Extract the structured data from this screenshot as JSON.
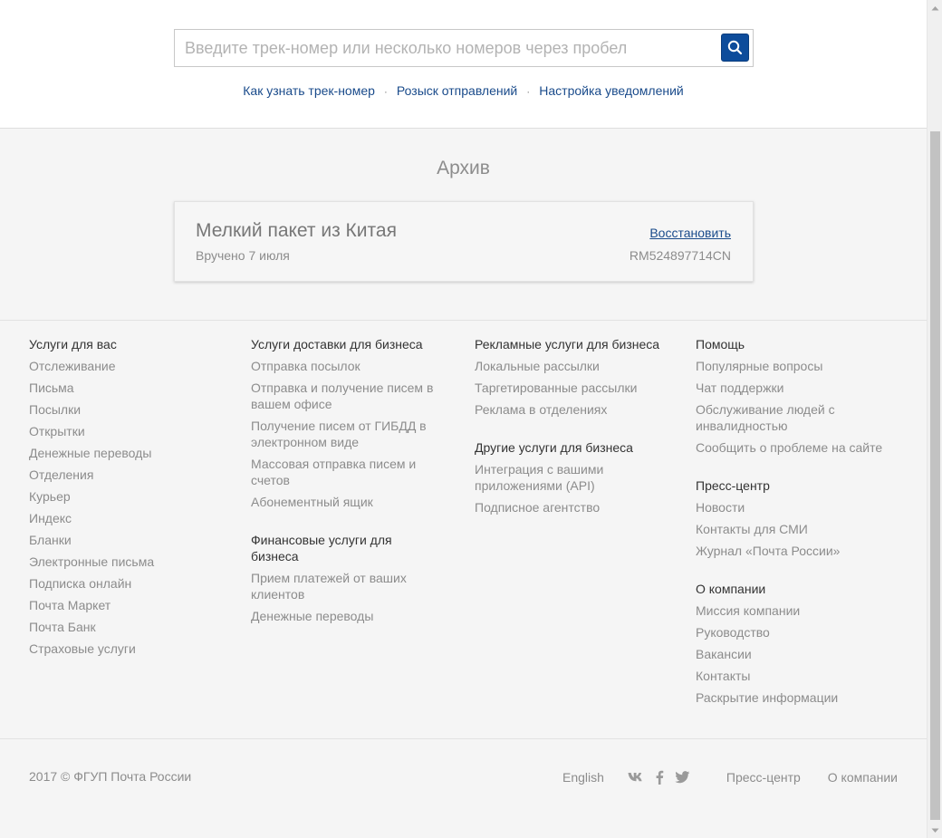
{
  "search": {
    "placeholder": "Введите трек-номер или несколько номеров через пробел",
    "value": ""
  },
  "header_links": [
    {
      "label": "Как узнать трек-номер"
    },
    {
      "label": "Розыск отправлений"
    },
    {
      "label": "Настройка уведомлений"
    }
  ],
  "separator": "·",
  "archive": {
    "title": "Архив",
    "item": {
      "title": "Мелкий пакет из Китая",
      "status": "Вручено 7 июля",
      "restore_label": "Восстановить",
      "track_number": "RM524897714CN"
    }
  },
  "footer": {
    "col1": {
      "groups": [
        {
          "title": "Услуги для вас",
          "links": [
            "Отслеживание",
            "Письма",
            "Посылки",
            "Открытки",
            "Денежные переводы",
            "Отделения",
            "Курьер",
            "Индекс",
            "Бланки",
            "Электронные письма",
            "Подписка онлайн",
            "Почта Маркет",
            "Почта Банк",
            "Страховые услуги"
          ]
        }
      ]
    },
    "col2": {
      "groups": [
        {
          "title": "Услуги доставки для бизнеса",
          "links": [
            "Отправка посылок",
            "Отправка и получение писем в вашем офисе",
            "Получение писем от ГИБДД в электронном виде",
            "Массовая отправка писем и счетов",
            "Абонементный ящик"
          ]
        },
        {
          "title": "Финансовые услуги для бизнеса",
          "links": [
            "Прием платежей от ваших клиентов",
            "Денежные переводы"
          ]
        }
      ]
    },
    "col3": {
      "groups": [
        {
          "title": "Рекламные услуги для бизнеса",
          "links": [
            "Локальные рассылки",
            "Таргетированные рассылки",
            "Реклама в отделениях"
          ]
        },
        {
          "title": "Другие услуги для бизнеса",
          "links": [
            "Интеграция с вашими приложениями (API)",
            "Подписное агентство"
          ]
        }
      ]
    },
    "col4": {
      "groups": [
        {
          "title": "Помощь",
          "links": [
            "Популярные вопросы",
            "Чат поддержки",
            "Обслуживание людей с инвалидностью",
            "Сообщить о проблеме на сайте"
          ]
        },
        {
          "title": "Пресс-центр",
          "links": [
            "Новости",
            "Контакты для СМИ",
            "Журнал «Почта России»"
          ]
        },
        {
          "title": "О компании",
          "links": [
            "Миссия компании",
            "Руководство",
            "Вакансии",
            "Контакты",
            "Раскрытие информации"
          ]
        }
      ]
    }
  },
  "bottom": {
    "copyright": "2017 © ФГУП Почта России",
    "language": "English",
    "social_icons": [
      "vk-icon",
      "facebook-icon",
      "twitter-icon"
    ],
    "press_link": "Пресс-центр",
    "about_link": "О компании"
  },
  "colors": {
    "accent": "#0d4c9b",
    "link": "#1a4b8b",
    "muted_text": "#8c8c8c",
    "page_bg": "#f5f5f5"
  }
}
